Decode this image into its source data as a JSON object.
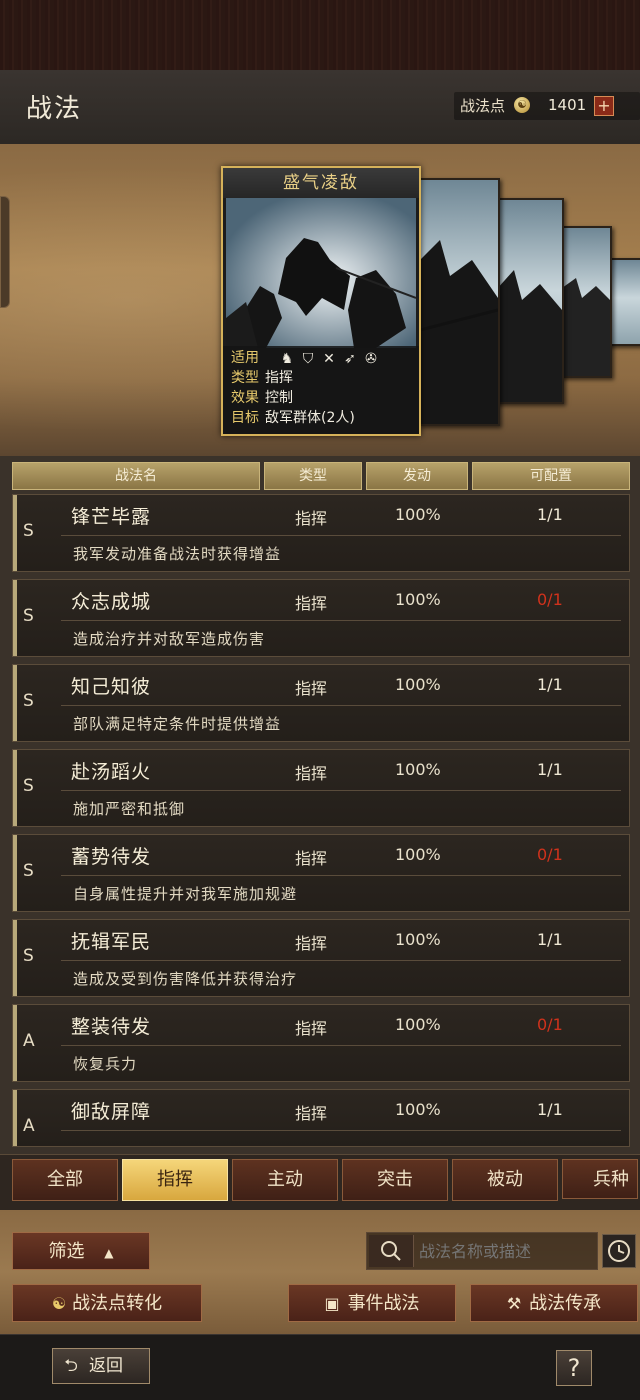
{
  "header": {
    "title": "战法",
    "points_label": "战法点",
    "points_value": "1401",
    "plus": "+"
  },
  "featured_card": {
    "name": "盛气凌敌",
    "rows": [
      {
        "k": "适用",
        "v": ""
      },
      {
        "k": "类型",
        "v": "指挥"
      },
      {
        "k": "效果",
        "v": "控制"
      },
      {
        "k": "目标",
        "v": "敌军群体(2人)"
      }
    ],
    "applies_icons": [
      "cavalry-icon",
      "shield-icon",
      "bow-icon",
      "spear-icon",
      "chariot-icon"
    ]
  },
  "table": {
    "headers": {
      "name": "战法名",
      "type": "类型",
      "trigger": "发动",
      "config": "可配置"
    },
    "rows": [
      {
        "grade": "S",
        "name": "锋芒毕露",
        "type": "指挥",
        "pct": "100%",
        "cfg": "1/1",
        "desc": "我军发动准备战法时获得增益"
      },
      {
        "grade": "S",
        "name": "众志成城",
        "type": "指挥",
        "pct": "100%",
        "cfg": "0/1",
        "desc": "造成治疗并对敌军造成伤害"
      },
      {
        "grade": "S",
        "name": "知己知彼",
        "type": "指挥",
        "pct": "100%",
        "cfg": "1/1",
        "desc": "部队满足特定条件时提供增益"
      },
      {
        "grade": "S",
        "name": "赴汤蹈火",
        "type": "指挥",
        "pct": "100%",
        "cfg": "1/1",
        "desc": "施加严密和抵御"
      },
      {
        "grade": "S",
        "name": "蓄势待发",
        "type": "指挥",
        "pct": "100%",
        "cfg": "0/1",
        "desc": "自身属性提升并对我军施加规避"
      },
      {
        "grade": "S",
        "name": "抚辑军民",
        "type": "指挥",
        "pct": "100%",
        "cfg": "1/1",
        "desc": "造成及受到伤害降低并获得治疗"
      },
      {
        "grade": "A",
        "name": "整装待发",
        "type": "指挥",
        "pct": "100%",
        "cfg": "0/1",
        "desc": "恢复兵力"
      },
      {
        "grade": "A",
        "name": "御敌屏障",
        "type": "指挥",
        "pct": "100%",
        "cfg": "1/1",
        "desc": ""
      }
    ]
  },
  "tabs": [
    "全部",
    "指挥",
    "主动",
    "突击",
    "被动",
    "兵种"
  ],
  "active_tab": "指挥",
  "controls": {
    "filter": "筛选",
    "search_placeholder": "战法名称或描述",
    "convert": "战法点转化",
    "event": "事件战法",
    "inherit": "战法传承",
    "back": "返回",
    "help": "?"
  }
}
